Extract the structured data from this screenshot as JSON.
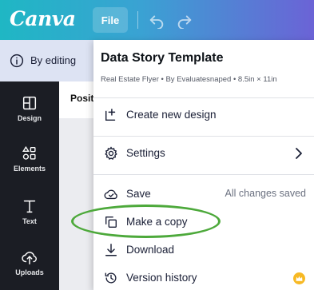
{
  "topbar": {
    "logo": "Canva",
    "file_label": "File",
    "icons": {
      "undo": "undo-icon",
      "redo": "redo-icon"
    },
    "colors": {
      "gradient_start": "#1fb7c4",
      "gradient_end": "#6b63d6"
    }
  },
  "infobar": {
    "text": "By editing",
    "icon": "info-icon"
  },
  "sidebar": {
    "items": [
      {
        "label": "Design",
        "icon": "design-icon"
      },
      {
        "label": "Elements",
        "icon": "elements-icon"
      },
      {
        "label": "Text",
        "icon": "text-icon"
      },
      {
        "label": "Uploads",
        "icon": "uploads-icon"
      }
    ]
  },
  "canvas": {
    "position_label": "Posit"
  },
  "file_menu": {
    "title": "Data Story Template",
    "subtitle": "Real Estate Flyer • By Evaluatesnaped • 8.5in × 11in",
    "items": {
      "create": {
        "label": "Create new design",
        "icon": "create-design-icon"
      },
      "settings": {
        "label": "Settings",
        "icon": "gear-icon"
      },
      "save": {
        "label": "Save",
        "status": "All changes saved",
        "icon": "cloud-check-icon"
      },
      "copy": {
        "label": "Make a copy",
        "icon": "copy-icon"
      },
      "download": {
        "label": "Download",
        "icon": "download-icon"
      },
      "history": {
        "label": "Version history",
        "icon": "history-icon",
        "badge": "crown-icon"
      }
    }
  },
  "annotation": {
    "color": "#4da93b",
    "target": "Make a copy"
  }
}
